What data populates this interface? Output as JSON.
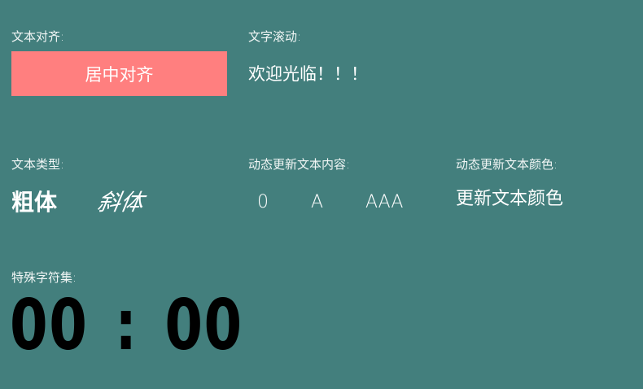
{
  "align_section": {
    "label": "文本对齐:",
    "box_text": "居中对齐",
    "box_color": "#ff7f7f"
  },
  "scroll_section": {
    "label": "文字滚动:",
    "text": "欢迎光临！！！"
  },
  "type_section": {
    "label": "文本类型:",
    "bold": "粗体",
    "italic": "斜体"
  },
  "dynamic_content_section": {
    "label": "动态更新文本内容:",
    "items": [
      "0",
      "A",
      "AAA"
    ]
  },
  "dynamic_color_section": {
    "label": "动态更新文本颜色:",
    "text": "更新文本颜色"
  },
  "special_chars_section": {
    "label": "特殊字符集:",
    "clock": {
      "minutes": "00",
      "separator": ":",
      "seconds": "00"
    }
  },
  "colors": {
    "background": "#437f7d",
    "text": "#ffffff",
    "clock": "#000000"
  }
}
